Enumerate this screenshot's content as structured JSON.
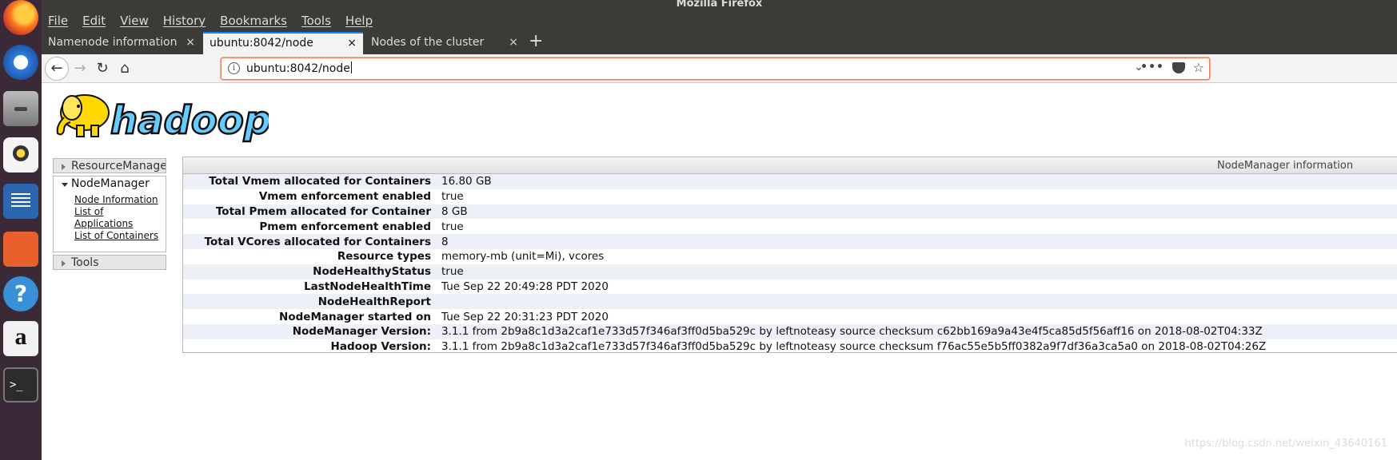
{
  "window": {
    "title": "Mozilla Firefox"
  },
  "menubar": {
    "items": [
      "File",
      "Edit",
      "View",
      "History",
      "Bookmarks",
      "Tools",
      "Help"
    ]
  },
  "tabs": [
    {
      "label": "Namenode information",
      "active": false
    },
    {
      "label": "ubuntu:8042/node",
      "active": true
    },
    {
      "label": "Nodes of the cluster",
      "active": false
    }
  ],
  "tab_close_glyph": "×",
  "new_tab_glyph": "+",
  "navbar": {
    "url": "ubuntu:8042/node",
    "back_glyph": "←",
    "forward_glyph": "→",
    "reload_glyph": "↻",
    "home_glyph": "⌂",
    "info_glyph": "i",
    "chevron_glyph": "⌄",
    "more_glyph": "•••",
    "star_glyph": "☆"
  },
  "dock": {
    "help_glyph": "?",
    "amazon_glyph": "a",
    "terminal_glyph": ">_"
  },
  "logo": {
    "text": "hadoop"
  },
  "sidebar": {
    "resource_manager": "ResourceManager",
    "node_manager": "NodeManager",
    "links": [
      "Node Information",
      "List of Applications",
      "List of Containers"
    ],
    "tools": "Tools"
  },
  "panel": {
    "title": "NodeManager information",
    "rows": [
      {
        "key": "Total Vmem allocated for Containers",
        "value": "16.80 GB"
      },
      {
        "key": "Vmem enforcement enabled",
        "value": "true"
      },
      {
        "key": "Total Pmem allocated for Container",
        "value": "8 GB"
      },
      {
        "key": "Pmem enforcement enabled",
        "value": "true"
      },
      {
        "key": "Total VCores allocated for Containers",
        "value": "8"
      },
      {
        "key": "Resource types",
        "value": "memory-mb (unit=Mi), vcores"
      },
      {
        "key": "NodeHealthyStatus",
        "value": "true"
      },
      {
        "key": "LastNodeHealthTime",
        "value": "Tue Sep 22 20:49:28 PDT 2020"
      },
      {
        "key": "NodeHealthReport",
        "value": ""
      },
      {
        "key": "NodeManager started on",
        "value": "Tue Sep 22 20:31:23 PDT 2020"
      },
      {
        "key": "NodeManager Version:",
        "value": "3.1.1 from 2b9a8c1d3a2caf1e733d57f346af3ff0d5ba529c by leftnoteasy source checksum c62bb169a9a43e4f5ca85d5f56aff16 on 2018-08-02T04:33Z"
      },
      {
        "key": "Hadoop Version:",
        "value": "3.1.1 from 2b9a8c1d3a2caf1e733d57f346af3ff0d5ba529c by leftnoteasy source checksum f76ac55e5b5ff0382a9f7df36a3ca5a0 on 2018-08-02T04:26Z"
      }
    ]
  },
  "watermark": "https://blog.csdn.net/weixin_43640161",
  "colors": {
    "dock_bg": "#3a2a37",
    "chrome_bg": "#3b3b38",
    "active_tab_accent": "#0a84ff",
    "urlbar_focus": "#e8805a",
    "row_stripe": "#eef0f8",
    "logo_yellow": "#ffd800",
    "logo_blue": "#66ccff"
  }
}
